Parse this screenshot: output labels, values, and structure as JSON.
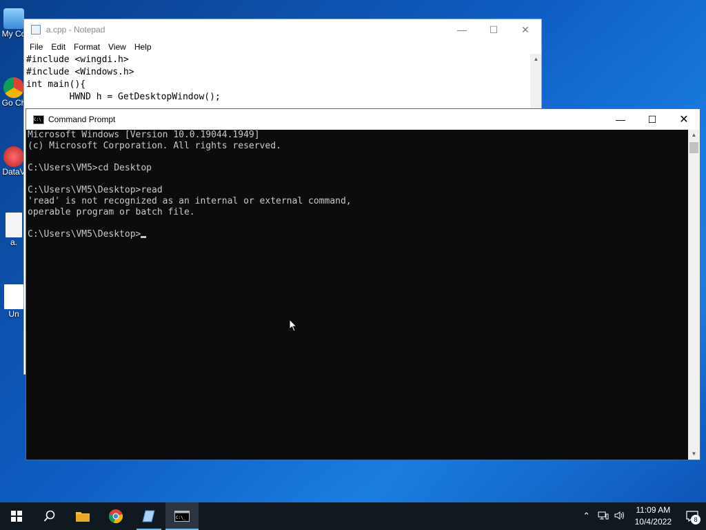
{
  "desktop": {
    "icons": [
      {
        "label": "My Co",
        "name": "this-pc"
      },
      {
        "label": "Go Ch",
        "name": "google-chrome"
      },
      {
        "label": "DataV",
        "name": "datav"
      },
      {
        "label": "a.",
        "name": "a-cpp-file"
      },
      {
        "label": "Un",
        "name": "untitled-file"
      }
    ]
  },
  "notepad": {
    "title": "a.cpp - Notepad",
    "menu": [
      "File",
      "Edit",
      "Format",
      "View",
      "Help"
    ],
    "lines": [
      "#include <wingdi.h>",
      "#include <Windows.h>",
      "int main(){",
      "        HWND h = GetDesktopWindow();"
    ]
  },
  "cmd": {
    "title": "Command Prompt",
    "lines": [
      "Microsoft Windows [Version 10.0.19044.1949]",
      "(c) Microsoft Corporation. All rights reserved.",
      "",
      "C:\\Users\\VM5>cd Desktop",
      "",
      "C:\\Users\\VM5\\Desktop>read",
      "'read' is not recognized as an internal or external command,",
      "operable program or batch file.",
      ""
    ],
    "prompt": "C:\\Users\\VM5\\Desktop>"
  },
  "taskbar": {
    "time": "11:09 AM",
    "date": "10/4/2022",
    "notification_count": "8"
  },
  "colors": {
    "taskbar_bg": "#101820",
    "accent": "#76b9ed",
    "console_bg": "#0c0c0c",
    "console_fg": "#c8c8c8"
  }
}
